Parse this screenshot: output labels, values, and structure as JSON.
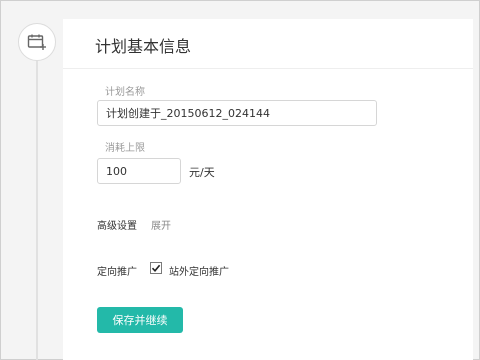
{
  "panel": {
    "title": "计划基本信息"
  },
  "rail": {
    "icon": "calendar-add-icon"
  },
  "plan_name": {
    "label": "计划名称",
    "value": "计划创建于_20150612_024144"
  },
  "spend_limit": {
    "label": "消耗上限",
    "value": "100",
    "unit": "元/天"
  },
  "advanced": {
    "label": "高级设置",
    "toggle": "展开"
  },
  "targeting": {
    "label": "定向推广",
    "checkbox_label": "站外定向推广",
    "checked": true
  },
  "actions": {
    "save_continue": "保存并继续"
  },
  "colors": {
    "accent": "#23b9a9"
  }
}
